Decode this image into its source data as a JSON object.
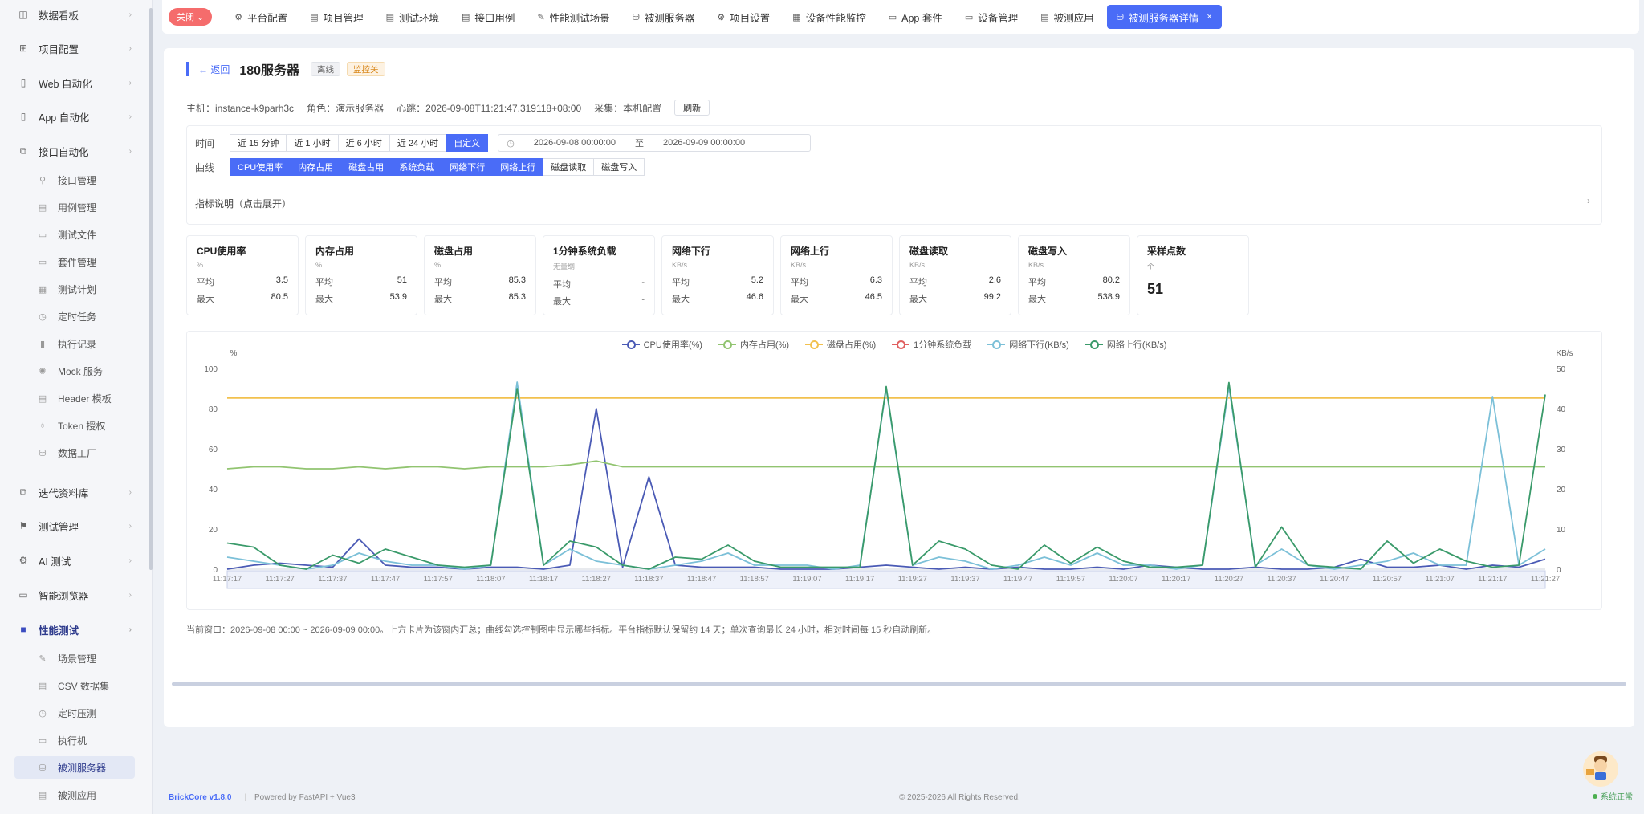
{
  "sidebar": {
    "items": [
      {
        "label": "数据看板",
        "icon": "dashboard-icon",
        "glyph": "◫"
      },
      {
        "label": "项目配置",
        "icon": "grid-icon",
        "glyph": "⊞"
      },
      {
        "label": "Web 自动化",
        "icon": "browser-icon",
        "glyph": "▯"
      },
      {
        "label": "App 自动化",
        "icon": "phone-icon",
        "glyph": "▯"
      },
      {
        "label": "接口自动化",
        "icon": "api-icon",
        "glyph": "⧉"
      }
    ],
    "api_subitems": [
      {
        "label": "接口管理",
        "icon": "link-icon",
        "glyph": "⚲"
      },
      {
        "label": "用例管理",
        "icon": "document-icon",
        "glyph": "▤"
      },
      {
        "label": "测试文件",
        "icon": "folder-icon",
        "glyph": "▭"
      },
      {
        "label": "套件管理",
        "icon": "folder-icon",
        "glyph": "▭"
      },
      {
        "label": "测试计划",
        "icon": "calendar-icon",
        "glyph": "▦"
      },
      {
        "label": "定时任务",
        "icon": "clock-icon",
        "glyph": "◷"
      },
      {
        "label": "执行记录",
        "icon": "bar-chart-icon",
        "glyph": "▮"
      },
      {
        "label": "Mock 服务",
        "icon": "mock-icon",
        "glyph": "✺"
      },
      {
        "label": "Header 模板",
        "icon": "template-icon",
        "glyph": "▤"
      },
      {
        "label": "Token 授权",
        "icon": "key-icon",
        "glyph": "♁"
      },
      {
        "label": "数据工厂",
        "icon": "database-icon",
        "glyph": "⛁"
      }
    ],
    "items2": [
      {
        "label": "迭代资料库",
        "icon": "library-icon",
        "glyph": "⧉"
      },
      {
        "label": "测试管理",
        "icon": "flag-icon",
        "glyph": "⚑"
      },
      {
        "label": "AI 测试",
        "icon": "ai-icon",
        "glyph": "⚙"
      },
      {
        "label": "智能浏览器",
        "icon": "monitor-icon",
        "glyph": "▭"
      },
      {
        "label": "性能测试",
        "icon": "performance-icon",
        "glyph": "■"
      }
    ],
    "perf_subitems": [
      {
        "label": "场景管理",
        "icon": "edit-icon",
        "glyph": "✎"
      },
      {
        "label": "CSV 数据集",
        "icon": "csv-icon",
        "glyph": "▤"
      },
      {
        "label": "定时压测",
        "icon": "alarm-icon",
        "glyph": "◷"
      },
      {
        "label": "执行机",
        "icon": "monitor-icon",
        "glyph": "▭"
      },
      {
        "label": "被测服务器",
        "icon": "server-icon",
        "glyph": "⛁"
      },
      {
        "label": "被测应用",
        "icon": "app-icon",
        "glyph": "▤"
      }
    ]
  },
  "topnav": {
    "close_label": "关闭 ⌄",
    "tabs": [
      {
        "label": "平台配置",
        "glyph": "⚙"
      },
      {
        "label": "项目管理",
        "glyph": "▤"
      },
      {
        "label": "测试环境",
        "glyph": "▤"
      },
      {
        "label": "接口用例",
        "glyph": "▤"
      },
      {
        "label": "性能测试场景",
        "glyph": "✎"
      },
      {
        "label": "被测服务器",
        "glyph": "⛁"
      },
      {
        "label": "项目设置",
        "glyph": "⚙"
      },
      {
        "label": "设备性能监控",
        "glyph": "▦"
      },
      {
        "label": "App 套件",
        "glyph": "▭"
      },
      {
        "label": "设备管理",
        "glyph": "▭"
      },
      {
        "label": "被测应用",
        "glyph": "▤"
      },
      {
        "label": "被测服务器详情",
        "glyph": "⛁"
      }
    ]
  },
  "header": {
    "back": "← 返回",
    "title": "180服务器",
    "tag_offline": "离线",
    "tag_monitoring": "监控关"
  },
  "meta": {
    "host": "主机：instance-k9parh3c",
    "role": "角色：演示服务器",
    "heartbeat": "心跳：2026-09-08T11:21:47.319118+08:00",
    "collect": "采集：本机配置",
    "refresh": "刷新"
  },
  "filter": {
    "time_label": "时间",
    "time_options": [
      "近 15 分钟",
      "近 1 小时",
      "近 6 小时",
      "近 24 小时",
      "自定义"
    ],
    "time_selected": 4,
    "start": "2026-09-08 00:00:00",
    "to": "至",
    "end": "2026-09-09 00:00:00",
    "curve_label": "曲线",
    "curves": [
      "CPU使用率",
      "内存占用",
      "磁盘占用",
      "系统负载",
      "网络下行",
      "网络上行",
      "磁盘读取",
      "磁盘写入"
    ],
    "curves_on": [
      true,
      true,
      true,
      true,
      true,
      true,
      false,
      false
    ],
    "explain": "指标说明（点击展开）"
  },
  "stats": [
    {
      "name": "CPU使用率",
      "unit": "%",
      "avg_label": "平均",
      "avg": "3.5",
      "max_label": "最大",
      "max": "80.5"
    },
    {
      "name": "内存占用",
      "unit": "%",
      "avg_label": "平均",
      "avg": "51",
      "max_label": "最大",
      "max": "53.9"
    },
    {
      "name": "磁盘占用",
      "unit": "%",
      "avg_label": "平均",
      "avg": "85.3",
      "max_label": "最大",
      "max": "85.3"
    },
    {
      "name": "1分钟系统负载",
      "unit": "无量纲",
      "avg_label": "平均",
      "avg": "-",
      "max_label": "最大",
      "max": "-"
    },
    {
      "name": "网络下行",
      "unit": "KB/s",
      "avg_label": "平均",
      "avg": "5.2",
      "max_label": "最大",
      "max": "46.6"
    },
    {
      "name": "网络上行",
      "unit": "KB/s",
      "avg_label": "平均",
      "avg": "6.3",
      "max_label": "最大",
      "max": "46.5"
    },
    {
      "name": "磁盘读取",
      "unit": "KB/s",
      "avg_label": "平均",
      "avg": "2.6",
      "max_label": "最大",
      "max": "99.2"
    },
    {
      "name": "磁盘写入",
      "unit": "KB/s",
      "avg_label": "平均",
      "avg": "80.2",
      "max_label": "最大",
      "max": "538.9"
    }
  ],
  "sample_stat": {
    "name": "采样点数",
    "unit": "个",
    "value": "51"
  },
  "chart_data": {
    "type": "line",
    "y_left_label": "%",
    "y_right_label": "KB/s",
    "ylim_left": [
      0,
      100
    ],
    "ylim_right": [
      0,
      50
    ],
    "left_ticks": [
      0,
      20,
      40,
      60,
      80,
      100
    ],
    "right_ticks": [
      0,
      10,
      20,
      30,
      40,
      50
    ],
    "x_ticks": [
      "11:17:17",
      "11:17:27",
      "11:17:37",
      "11:17:47",
      "11:17:57",
      "11:18:07",
      "11:18:17",
      "11:18:27",
      "11:18:37",
      "11:18:47",
      "11:18:57",
      "11:19:07",
      "11:19:17",
      "11:19:27",
      "11:19:37",
      "11:19:47",
      "11:19:57",
      "11:20:07",
      "11:20:17",
      "11:20:27",
      "11:20:37",
      "11:20:47",
      "11:20:57",
      "11:21:07",
      "11:21:17",
      "11:21:27"
    ],
    "series": [
      {
        "name": "CPU使用率(%)",
        "axis": "left",
        "color": "#4a5ab5",
        "values": [
          0,
          2,
          3,
          2,
          1,
          15,
          2,
          1,
          1,
          0,
          1,
          1,
          0,
          2,
          80,
          1,
          46,
          2,
          1,
          1,
          1,
          0,
          0,
          0,
          1,
          2,
          1,
          0,
          1,
          0,
          1,
          0,
          0,
          1,
          0,
          2,
          1,
          0,
          0,
          1,
          0,
          0,
          1,
          5,
          1,
          1,
          2,
          0,
          2,
          1,
          5
        ]
      },
      {
        "name": "内存占用(%)",
        "axis": "left",
        "color": "#91c470",
        "values": [
          50,
          51,
          51,
          50,
          50,
          51,
          50,
          51,
          51,
          50,
          51,
          51,
          51,
          52,
          53.9,
          51,
          51,
          51,
          51,
          51,
          51,
          51,
          51,
          51,
          51,
          51,
          51,
          51,
          51,
          51,
          51,
          51,
          51,
          51,
          51,
          51,
          51,
          51,
          51,
          51,
          51,
          51,
          51,
          51,
          51,
          51,
          51,
          51,
          51,
          51,
          51
        ]
      },
      {
        "name": "磁盘占用(%)",
        "axis": "left",
        "color": "#f2c14e",
        "values": [
          85.3,
          85.3,
          85.3,
          85.3,
          85.3,
          85.3,
          85.3,
          85.3,
          85.3,
          85.3,
          85.3,
          85.3,
          85.3,
          85.3,
          85.3,
          85.3,
          85.3,
          85.3,
          85.3,
          85.3,
          85.3,
          85.3,
          85.3,
          85.3,
          85.3,
          85.3,
          85.3,
          85.3,
          85.3,
          85.3,
          85.3,
          85.3,
          85.3,
          85.3,
          85.3,
          85.3,
          85.3,
          85.3,
          85.3,
          85.3,
          85.3,
          85.3,
          85.3,
          85.3,
          85.3,
          85.3,
          85.3,
          85.3,
          85.3,
          85.3,
          85.3
        ]
      },
      {
        "name": "1分钟系统负载",
        "axis": "left",
        "color": "#e06060",
        "values": []
      },
      {
        "name": "网络下行(KB/s)",
        "axis": "right",
        "color": "#7cc0d8",
        "values": [
          3,
          2,
          1,
          0,
          1,
          4,
          2,
          1,
          1,
          0,
          1,
          46.6,
          1,
          5,
          2,
          1,
          0,
          1,
          2,
          4,
          1,
          1,
          1,
          0,
          1,
          45,
          1,
          3,
          2,
          0,
          1,
          3,
          1,
          4,
          1,
          1,
          0,
          1,
          45.5,
          1,
          5,
          1,
          0,
          1,
          2,
          4,
          1,
          1,
          43,
          1,
          5
        ]
      },
      {
        "name": "网络上行(KB/s)",
        "axis": "right",
        "color": "#3a9a6a",
        "values": [
          6.5,
          5.5,
          1,
          0,
          3.5,
          1.5,
          5,
          3,
          1,
          0.5,
          1,
          45,
          1,
          7,
          5.5,
          1,
          0,
          3,
          2.5,
          6,
          2,
          0.5,
          0.5,
          0.5,
          0.5,
          45.5,
          1,
          7,
          5,
          1,
          0,
          6,
          1.5,
          5.5,
          2,
          0.5,
          0.5,
          1,
          46.5,
          0.5,
          10.5,
          1,
          0.5,
          0,
          7,
          1.5,
          5,
          2,
          0.5,
          1,
          43.5
        ]
      }
    ],
    "legend_position": "top-center",
    "grid": false
  },
  "footnote": "当前窗口：2026-09-08 00:00 ~ 2026-09-09 00:00。上方卡片为该窗内汇总；曲线勾选控制图中显示哪些指标。平台指标默认保留约 14 天；单次查询最长 24 小时，相对时间每 15 秒自动刷新。",
  "footer": {
    "brand": "BrickCore v1.8.0",
    "powered": "Powered by FastAPI + Vue3",
    "copyright": "© 2025-2026 All Rights Reserved.",
    "status": "系统正常"
  }
}
